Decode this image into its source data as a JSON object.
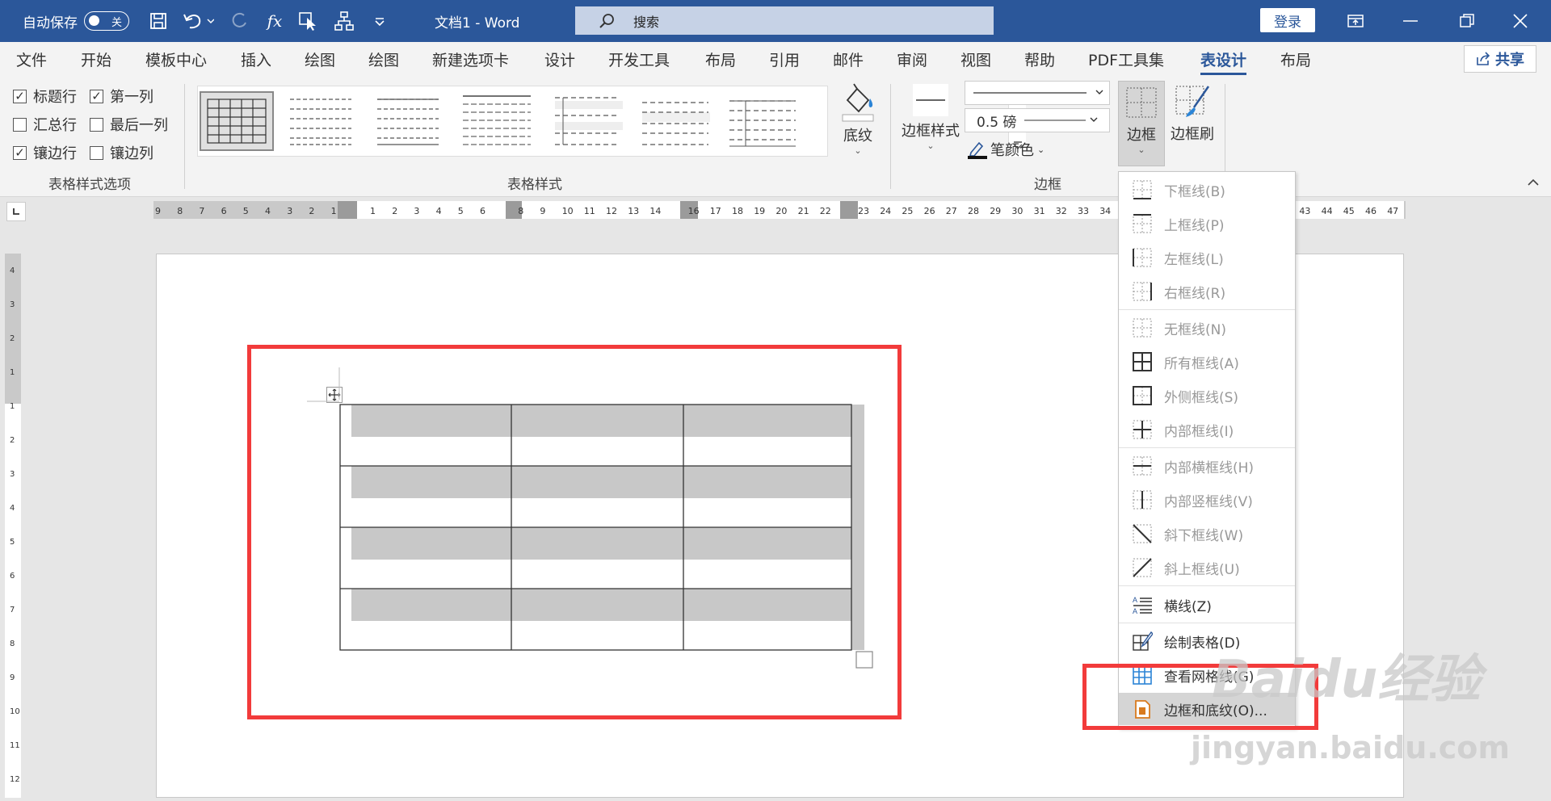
{
  "titlebar": {
    "autosave_label": "自动保存",
    "autosave_state": "关",
    "doc_title": "文档1 - Word",
    "search_placeholder": "搜索",
    "login_label": "登录"
  },
  "tabs": [
    {
      "label": "文件"
    },
    {
      "label": "开始"
    },
    {
      "label": "模板中心"
    },
    {
      "label": "插入"
    },
    {
      "label": "绘图"
    },
    {
      "label": "绘图"
    },
    {
      "label": "新建选项卡"
    },
    {
      "label": "设计"
    },
    {
      "label": "开发工具"
    },
    {
      "label": "布局"
    },
    {
      "label": "引用"
    },
    {
      "label": "邮件"
    },
    {
      "label": "审阅"
    },
    {
      "label": "视图"
    },
    {
      "label": "帮助"
    },
    {
      "label": "PDF工具集"
    },
    {
      "label": "表设计"
    },
    {
      "label": "布局"
    }
  ],
  "active_tab": "表设计",
  "share_label": "共享",
  "style_options": {
    "group_label": "表格样式选项",
    "items": [
      {
        "label": "标题行",
        "checked": true
      },
      {
        "label": "第一列",
        "checked": true
      },
      {
        "label": "汇总行",
        "checked": false
      },
      {
        "label": "最后一列",
        "checked": false
      },
      {
        "label": "镶边行",
        "checked": true
      },
      {
        "label": "镶边列",
        "checked": false
      }
    ]
  },
  "table_styles": {
    "group_label": "表格样式",
    "shading_label": "底纹"
  },
  "borders": {
    "group_label": "边框",
    "border_styles_label": "边框样式",
    "weight_value": "0.5 磅",
    "pen_color_label": "笔颜色",
    "borders_label": "边框",
    "painter_label": "边框刷"
  },
  "ruler": {
    "numbers_left": [
      "9",
      "8",
      "7",
      "6",
      "5",
      "4",
      "3",
      "2",
      "1"
    ],
    "numbers_mid": [
      "1",
      "2",
      "3",
      "4",
      "5",
      "6",
      "8",
      "9",
      "10",
      "11",
      "12",
      "13",
      "14",
      "16",
      "17",
      "18",
      "19",
      "20",
      "21",
      "22",
      "23",
      "24",
      "25",
      "26",
      "27",
      "28",
      "29",
      "30",
      "31",
      "32",
      "33",
      "34",
      "43",
      "44",
      "45",
      "46",
      "47"
    ]
  },
  "vruler": {
    "numbers": [
      "4",
      "3",
      "2",
      "1",
      "1",
      "2",
      "3",
      "4",
      "5",
      "6",
      "7",
      "8",
      "9",
      "10",
      "11",
      "12"
    ]
  },
  "border_menu": {
    "items": [
      {
        "label": "下框线(B)",
        "icon": "border-bottom-icon",
        "enabled": false
      },
      {
        "label": "上框线(P)",
        "icon": "border-top-icon",
        "enabled": false
      },
      {
        "label": "左框线(L)",
        "icon": "border-left-icon",
        "enabled": false
      },
      {
        "label": "右框线(R)",
        "icon": "border-right-icon",
        "enabled": false
      },
      {
        "label": "无框线(N)",
        "icon": "border-none-icon",
        "enabled": false
      },
      {
        "label": "所有框线(A)",
        "icon": "border-all-icon",
        "enabled": false
      },
      {
        "label": "外侧框线(S)",
        "icon": "border-outside-icon",
        "enabled": false
      },
      {
        "label": "内部框线(I)",
        "icon": "border-inside-icon",
        "enabled": false
      },
      {
        "label": "内部横框线(H)",
        "icon": "border-inside-h-icon",
        "enabled": false
      },
      {
        "label": "内部竖框线(V)",
        "icon": "border-inside-v-icon",
        "enabled": false
      },
      {
        "label": "斜下框线(W)",
        "icon": "diag-down-icon",
        "enabled": false
      },
      {
        "label": "斜上框线(U)",
        "icon": "diag-up-icon",
        "enabled": false
      },
      {
        "label": "横线(Z)",
        "icon": "horizontal-line-icon",
        "enabled": true
      },
      {
        "label": "绘制表格(D)",
        "icon": "draw-table-icon",
        "enabled": true
      },
      {
        "label": "查看网格线(G)",
        "icon": "gridlines-icon",
        "enabled": true
      },
      {
        "label": "边框和底纹(O)...",
        "icon": "borders-shading-icon",
        "enabled": true
      }
    ]
  },
  "watermark": {
    "brand": "Baidu经验",
    "url": "jingyan.baidu.com"
  },
  "colors": {
    "accent": "#2b579a",
    "highlight_border": "#f23b3b",
    "table_shade": "#c8c8c8"
  }
}
